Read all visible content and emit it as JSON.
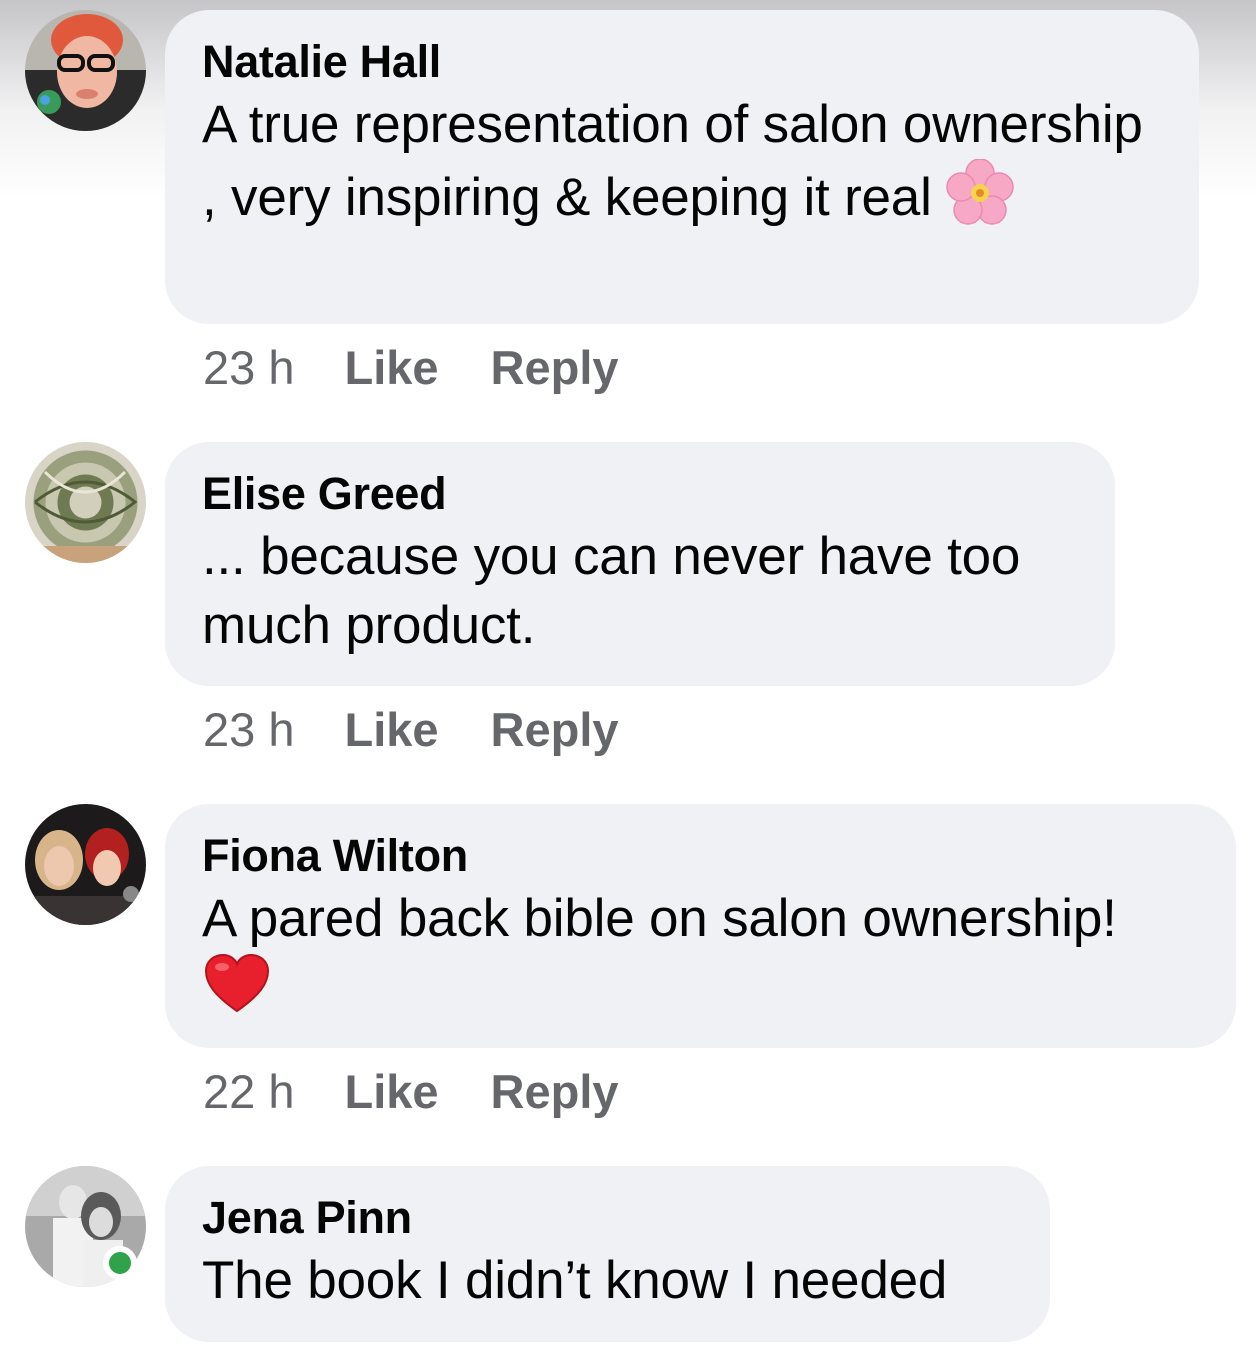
{
  "comments": [
    {
      "author": "Natalie Hall",
      "text": "A true representation of salon ownership , very inspiring & keeping it real",
      "emoji": "cherry-blossom-icon",
      "time": "23 h",
      "like_label": "Like",
      "reply_label": "Reply"
    },
    {
      "author": "Elise Greed",
      "text": "... because you can never have too much product.",
      "time": "23 h",
      "like_label": "Like",
      "reply_label": "Reply"
    },
    {
      "author": "Fiona Wilton",
      "text": "A pared back bible on salon ownership!",
      "emoji": "red-heart-icon",
      "time": "22 h",
      "like_label": "Like",
      "reply_label": "Reply"
    },
    {
      "author": "Jena Pinn",
      "text": "The book I didn’t know I needed",
      "online": true
    }
  ],
  "colors": {
    "bubble": "#f0f1f4",
    "meta_text": "#65676b",
    "online": "#31a24c"
  }
}
